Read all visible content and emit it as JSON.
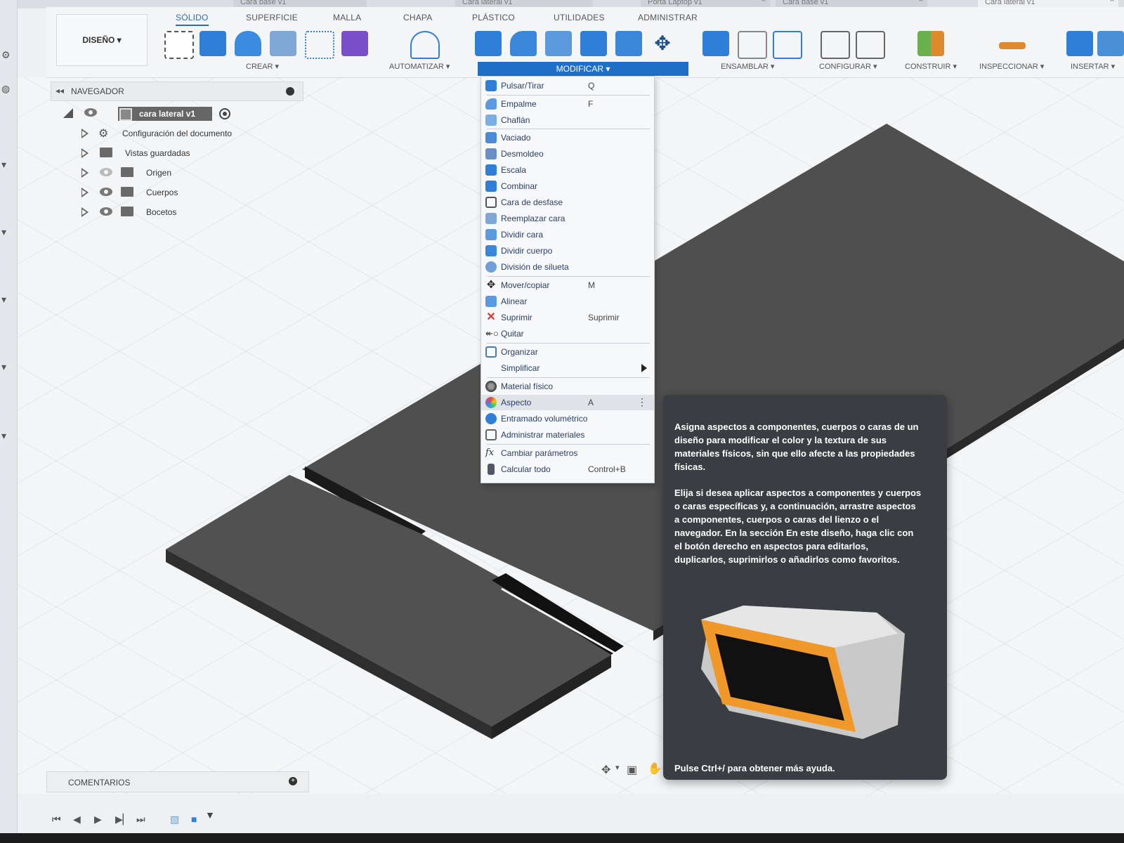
{
  "browser_tabs": [
    {
      "label": "Cara base v1"
    },
    {
      "label": "Cara lateral v1"
    },
    {
      "label": "Porta Laptop v1"
    },
    {
      "label": "Cara base v1"
    },
    {
      "label": "Cara lateral v1"
    }
  ],
  "toolbar": {
    "design_label": "DISEÑO ▾",
    "tabs": [
      "SÓLIDO",
      "SUPERFICIE",
      "MALLA",
      "CHAPA",
      "PLÁSTICO",
      "UTILIDADES",
      "ADMINISTRAR"
    ],
    "groups": {
      "create": "CREAR ▾",
      "automate": "AUTOMATIZAR ▾",
      "modify": "MODIFICAR ▾",
      "assemble": "ENSAMBLAR ▾",
      "configure": "CONFIGURAR ▾",
      "construct": "CONSTRUIR ▾",
      "inspect": "INSPECCIONAR ▾",
      "insert": "INSERTAR ▾"
    }
  },
  "navigator": {
    "title": "NAVEGADOR",
    "root": "cara lateral v1",
    "items": [
      {
        "label": "Configuración del documento"
      },
      {
        "label": "Vistas guardadas"
      },
      {
        "label": "Origen"
      },
      {
        "label": "Cuerpos"
      },
      {
        "label": "Bocetos"
      }
    ]
  },
  "menu": {
    "items": [
      {
        "label": "Pulsar/Tirar",
        "shortcut": "Q"
      },
      {
        "label": "Empalme",
        "shortcut": "F"
      },
      {
        "label": "Chaflán",
        "shortcut": ""
      },
      {
        "label": "Vaciado",
        "shortcut": ""
      },
      {
        "label": "Desmoldeo",
        "shortcut": ""
      },
      {
        "label": "Escala",
        "shortcut": ""
      },
      {
        "label": "Combinar",
        "shortcut": ""
      },
      {
        "label": "Cara de desfase",
        "shortcut": ""
      },
      {
        "label": "Reemplazar cara",
        "shortcut": ""
      },
      {
        "label": "Dividir cara",
        "shortcut": ""
      },
      {
        "label": "Dividir cuerpo",
        "shortcut": ""
      },
      {
        "label": "División de silueta",
        "shortcut": ""
      },
      {
        "label": "Mover/copiar",
        "shortcut": "M"
      },
      {
        "label": "Alinear",
        "shortcut": ""
      },
      {
        "label": "Suprimir",
        "shortcut": "Suprimir"
      },
      {
        "label": "Quitar",
        "shortcut": ""
      },
      {
        "label": "Organizar",
        "shortcut": ""
      },
      {
        "label": "Simplificar",
        "shortcut": ""
      },
      {
        "label": "Material físico",
        "shortcut": ""
      },
      {
        "label": "Aspecto",
        "shortcut": "A"
      },
      {
        "label": "Entramado volumétrico",
        "shortcut": ""
      },
      {
        "label": "Administrar materiales",
        "shortcut": ""
      },
      {
        "label": "Cambiar parámetros",
        "shortcut": ""
      },
      {
        "label": "Calcular todo",
        "shortcut": "Control+B"
      }
    ]
  },
  "tooltip": {
    "para1": "Asigna aspectos a componentes, cuerpos o caras de un diseño para modificar el color y la textura de sus materiales físicos, sin que ello afecte a las propiedades físicas.",
    "para2": "Elija si desea aplicar aspectos a componentes y cuerpos o caras específicas y, a continuación, arrastre aspectos a componentes, cuerpos o caras del lienzo o el navegador. En la sección En este diseño, haga clic con el botón derecho en aspectos para editarlos, duplicarlos, suprimirlos o añadirlos como favoritos.",
    "footer": "Pulse Ctrl+/ para obtener más ayuda."
  },
  "comments": {
    "label": "COMENTARIOS"
  },
  "colors": {
    "accent": "#1f6fc6",
    "tooltip_bg": "#3a3d41",
    "model": "#4a4a4a"
  }
}
